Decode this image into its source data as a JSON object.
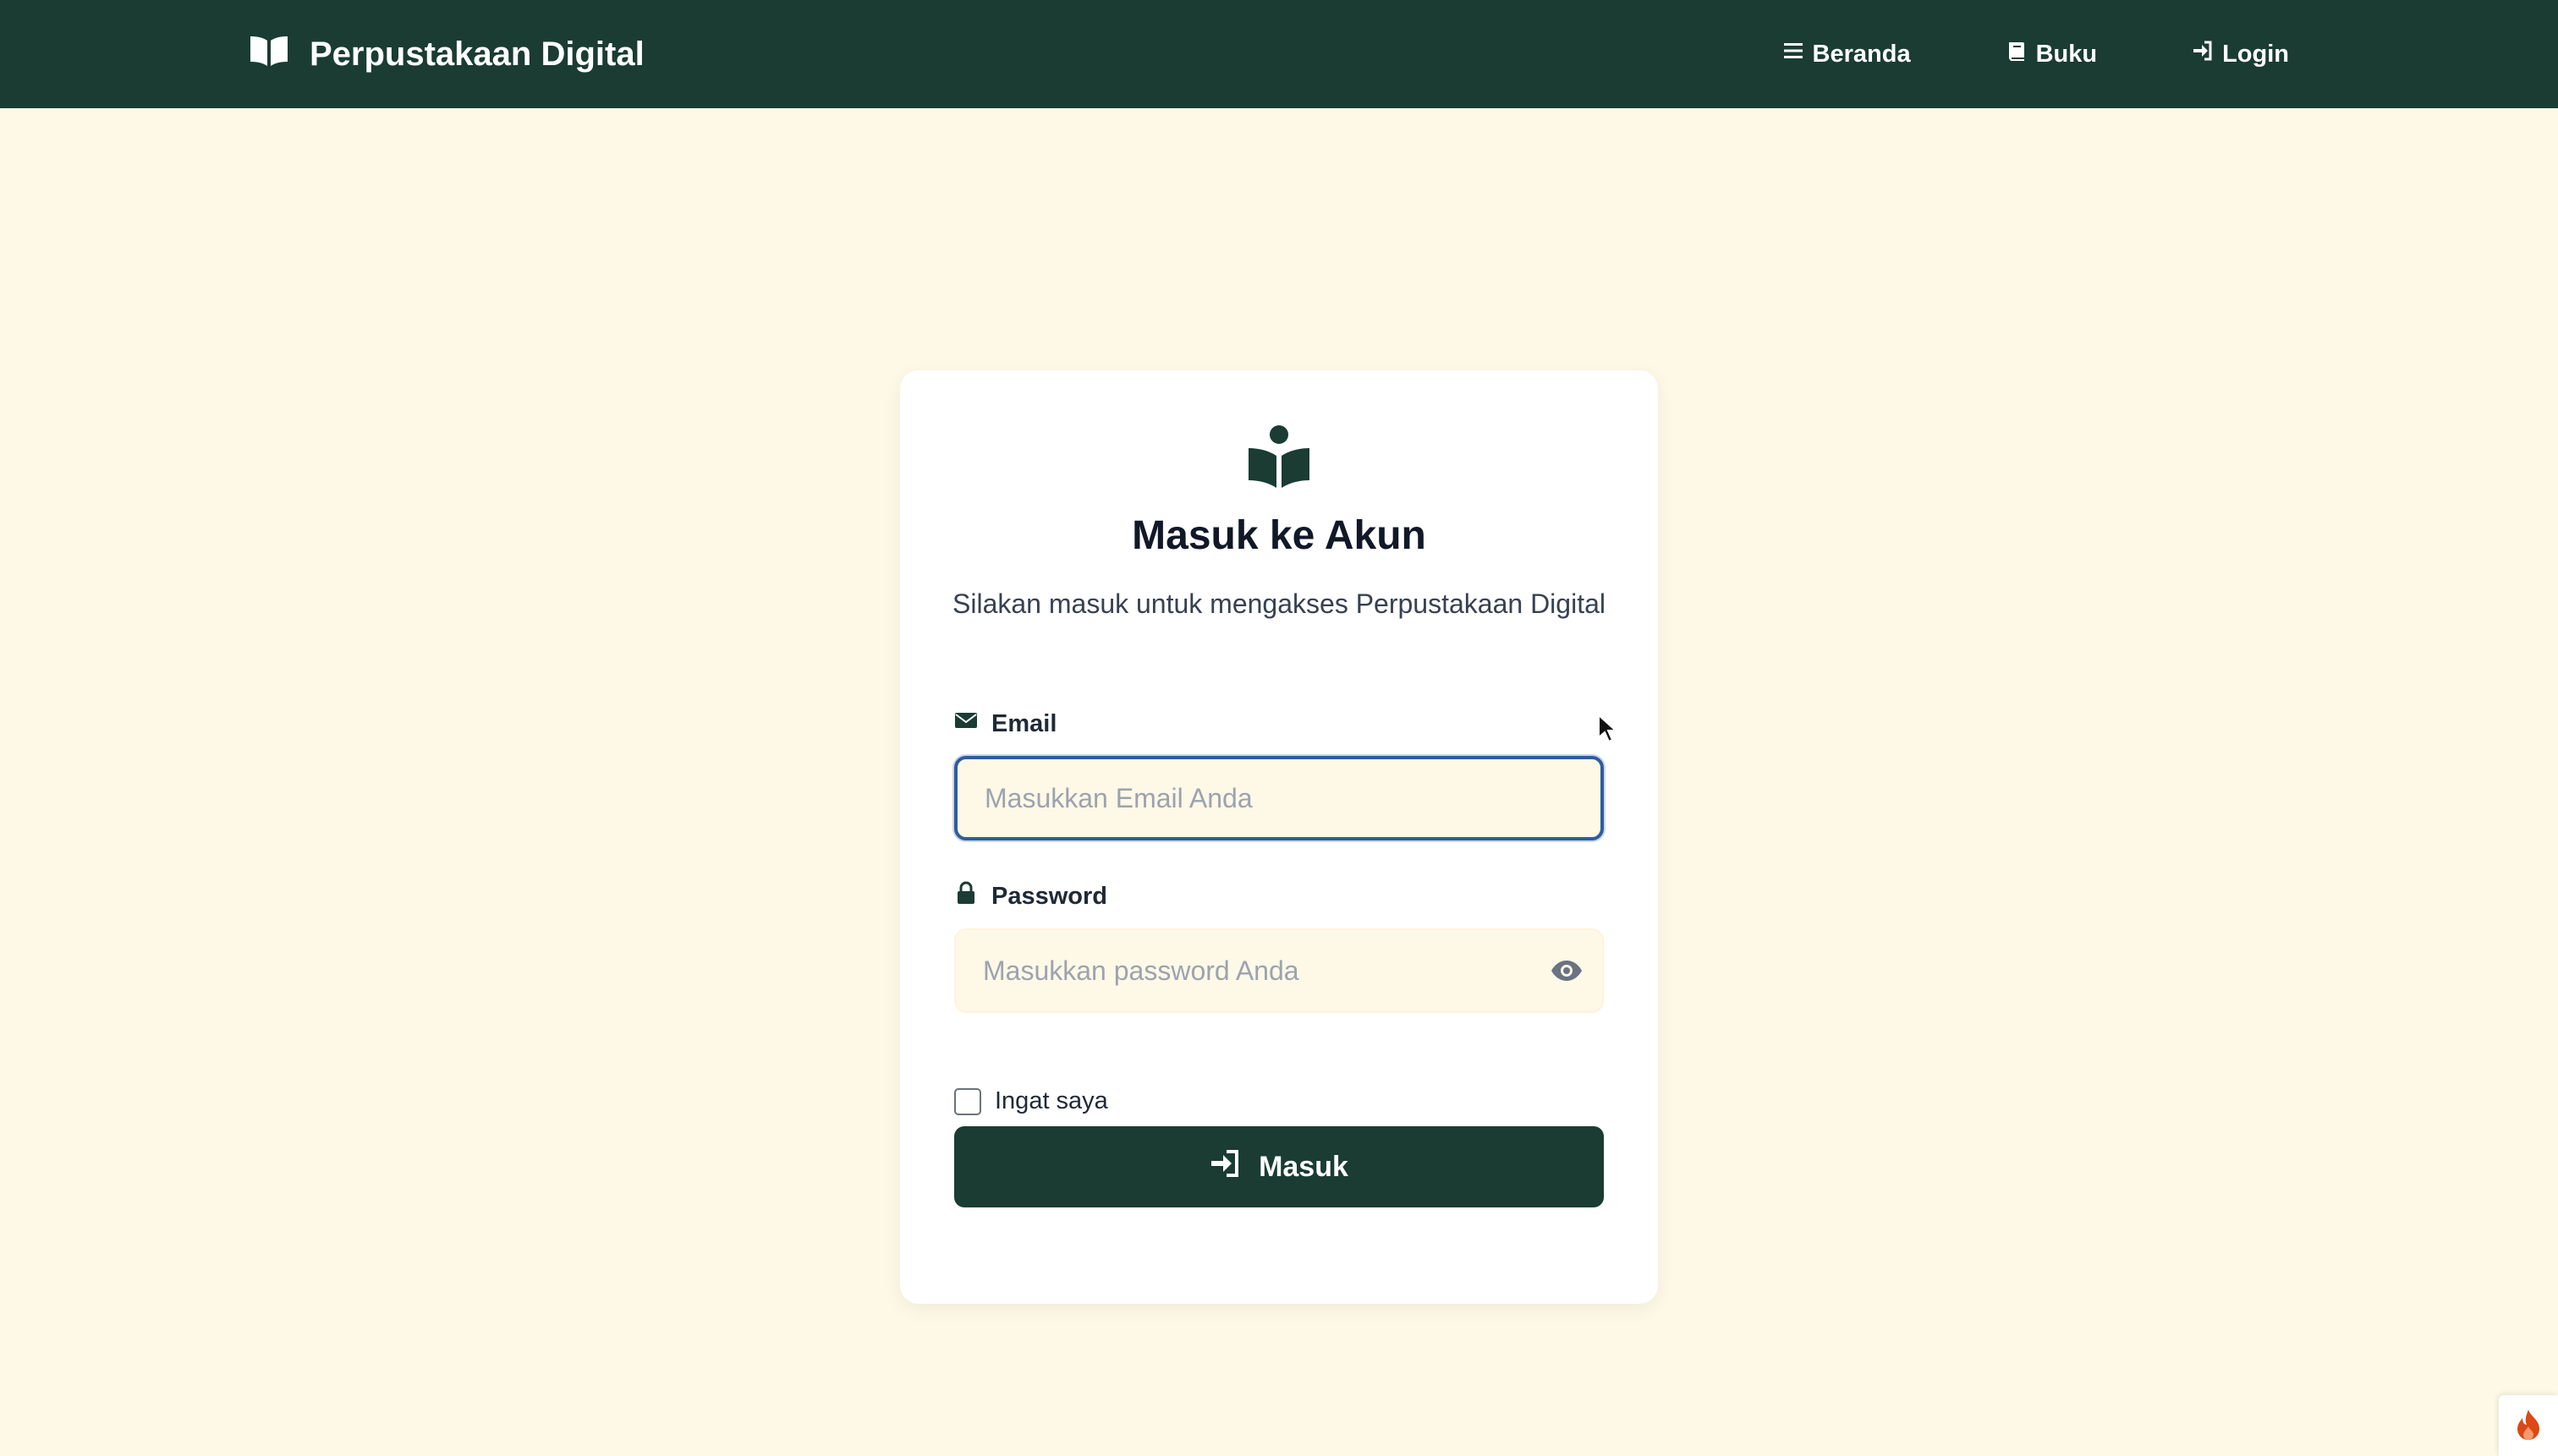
{
  "navbar": {
    "brand": "Perpustakaan Digital",
    "brand_icon": "open-book-icon",
    "links": [
      {
        "label": "Beranda",
        "icon": "bars-icon"
      },
      {
        "label": "Buku",
        "icon": "book-icon"
      },
      {
        "label": "Login",
        "icon": "sign-in-icon"
      }
    ]
  },
  "login": {
    "icon": "book-reader-icon",
    "title": "Masuk ke Akun",
    "subtitle": "Silakan masuk untuk mengakses Perpustakaan Digital",
    "email_label": "Email",
    "email_placeholder": "Masukkan Email Anda",
    "email_value": "",
    "password_label": "Password",
    "password_placeholder": "Masukkan password Anda",
    "password_value": "",
    "remember_label": "Ingat saya",
    "remember_checked": false,
    "submit_label": "Masuk"
  },
  "colors": {
    "primary": "#1a3c32",
    "background": "#fef8e7",
    "focus_ring": "#2f5d9c"
  }
}
